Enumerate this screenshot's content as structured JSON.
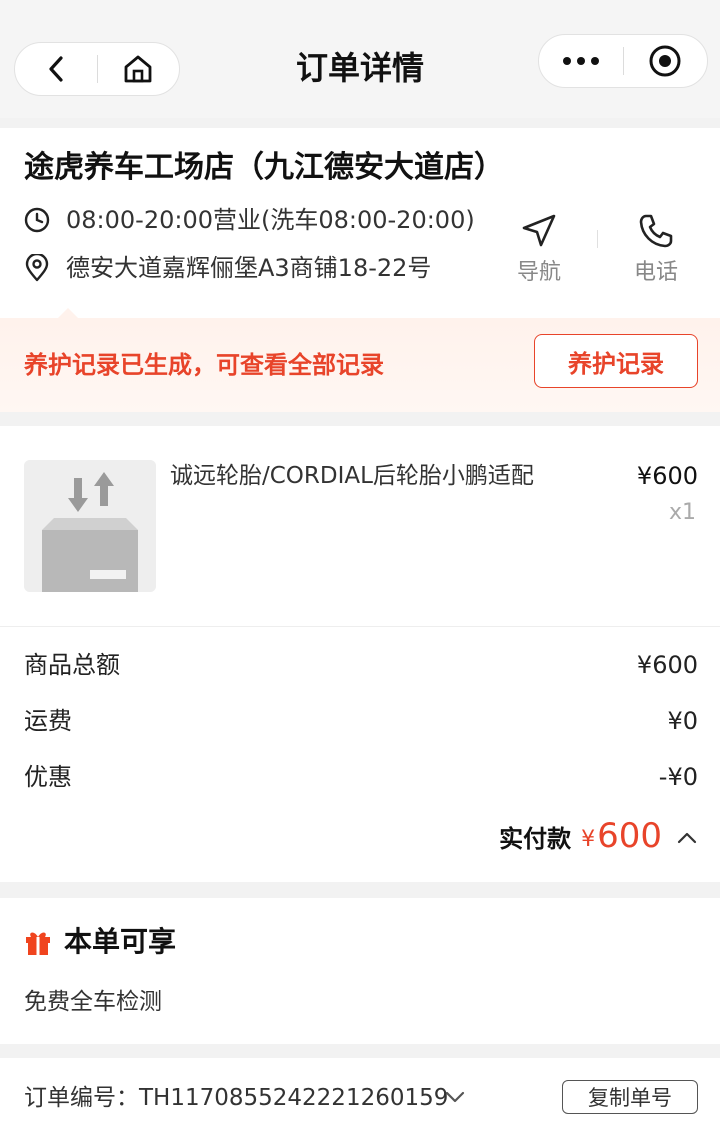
{
  "header": {
    "title": "订单详情",
    "back_icon": "chevron-left-icon",
    "home_icon": "home-icon",
    "more_icon": "more-dots-icon",
    "close_icon": "target-circle-icon"
  },
  "store": {
    "name": "途虎养车工场店（九江德安大道店）",
    "hours": "08:00-20:00营业(洗车08:00-20:00)",
    "address": "德安大道嘉辉俪堡A3商铺18-22号",
    "nav_label": "导航",
    "phone_label": "电话"
  },
  "notice": {
    "text": "养护记录已生成，可查看全部记录",
    "button_label": "养护记录"
  },
  "product": {
    "name": "诚远轮胎/CORDIAL后轮胎小鹏适配",
    "price": "¥600",
    "qty": "x1"
  },
  "summary": {
    "rows": [
      {
        "label": "商品总额",
        "value": "¥600"
      },
      {
        "label": "运费",
        "value": "¥0"
      },
      {
        "label": "优惠",
        "value": "-¥0"
      }
    ],
    "paid_label": "实付款",
    "paid_currency": "¥",
    "paid_value": "600"
  },
  "benefits": {
    "title": "本单可享",
    "item": "免费全车检测"
  },
  "order": {
    "label": "订单编号：TH11708552422212601​59",
    "copy_label": "复制单号"
  },
  "colors": {
    "accent": "#e8442a",
    "page_bg": "#f2f2f2"
  }
}
